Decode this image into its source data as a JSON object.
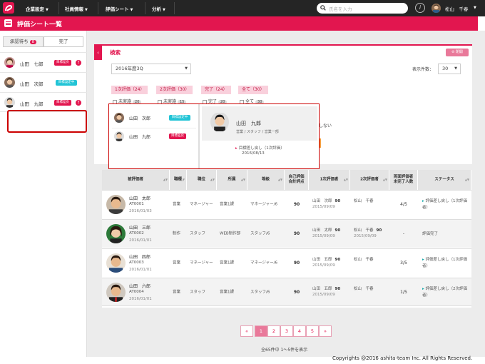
{
  "nav": {
    "items": [
      "企業設定",
      "社員情報",
      "評価シート",
      "分析"
    ],
    "search_placeholder": "氏名を入力",
    "user_name": "松山　千春"
  },
  "page_title": "評価シート一覧",
  "sidebar": {
    "tab_pending": "承認待ち",
    "tab_pending_count": "8",
    "tab_done": "完了",
    "people": [
      {
        "name": "山田　七郎",
        "badge": "目標差戻",
        "badge_color": "#e2164f"
      },
      {
        "name": "山田　次郎",
        "badge": "目標設定中",
        "badge_color": "#22c4d6"
      },
      {
        "name": "山田　九郎",
        "badge": "目標差戻",
        "badge_color": "#e2164f"
      }
    ]
  },
  "search": {
    "title": "検索",
    "close_label": "閉開",
    "period": "2016年度3Q",
    "page_size_label": "表示件数：",
    "page_size": "30",
    "chips": [
      "1次評価（24）",
      "2次評価（30）",
      "完了（24）",
      "全て（30）"
    ],
    "filters": [
      {
        "label": "未実施",
        "count": "20"
      },
      {
        "label": "未実施",
        "count": "15"
      },
      {
        "label": "完了",
        "count": "20"
      },
      {
        "label": "全て",
        "count": "30"
      }
    ],
    "hint": "しない"
  },
  "popup": {
    "list": [
      {
        "name": "山田　次郎",
        "badge": "目標設定中",
        "badge_color": "#22c4d6"
      },
      {
        "name": "山田　九郎",
        "badge": "目標差戻",
        "badge_color": "#e2164f"
      }
    ],
    "card_name": "山田　九郎",
    "card_dept": "営業 / スタッフ / 営業一部",
    "event": "目標差し戻し（1次評価）",
    "event_date": "2016/08/13"
  },
  "table": {
    "headers": [
      "被評価者",
      "職種",
      "職位",
      "所属",
      "等級",
      "自己評価\n合計評点",
      "1次評価者",
      "2次評価者",
      "両面評価者\n未完了人数",
      "ステータス"
    ],
    "rows": [
      {
        "name": "山田　太郎",
        "id": "AT0001",
        "date": "2016/01/03",
        "job": "営業",
        "position": "マネージャー",
        "dept": "営業1課",
        "grade": "マネージャー/6",
        "self_score": "90",
        "ev1_name": "山田　次郎",
        "ev1_score": "90",
        "ev1_date": "2015/09/09",
        "ev2_name": "松山　千春",
        "ev2_score": "",
        "ev2_date": "",
        "remaining": "4/5",
        "status": "評価差し戻し（1次評価者）"
      },
      {
        "name": "山田　三郎",
        "id": "AT0002",
        "date": "2016/01/01",
        "job": "制作",
        "position": "スタッフ",
        "dept": "WEB制作部",
        "grade": "スタッフ/6",
        "self_score": "90",
        "ev1_name": "山田　太郎",
        "ev1_score": "90",
        "ev1_date": "2015/09/09",
        "ev2_name": "松山　千春",
        "ev2_score": "90",
        "ev2_date": "2015/09/09",
        "remaining": "-",
        "status": "評価完了"
      },
      {
        "name": "山田　四郎",
        "id": "AT0003",
        "date": "2016/01/01",
        "job": "営業",
        "position": "マネージャー",
        "dept": "営業1課",
        "grade": "マネージャー/6",
        "self_score": "90",
        "ev1_name": "山田　五郎",
        "ev1_score": "90",
        "ev1_date": "2015/09/09",
        "ev2_name": "松山　千春",
        "ev2_score": "",
        "ev2_date": "",
        "remaining": "3/5",
        "status": "評価差し戻し（1次評価者）"
      },
      {
        "name": "山田　六郎",
        "id": "AT0004",
        "date": "2016/01/01",
        "job": "営業",
        "position": "スタッフ",
        "dept": "営業1課",
        "grade": "スタッフ/6",
        "self_score": "90",
        "ev1_name": "山田　五郎",
        "ev1_score": "90",
        "ev1_date": "2015/09/09",
        "ev2_name": "松山　千春",
        "ev2_score": "",
        "ev2_date": "",
        "remaining": "1/5",
        "status": "評価差し戻し（2次評価者）"
      }
    ]
  },
  "pagination": {
    "pages": [
      "«",
      "1",
      "2",
      "3",
      "4",
      "5",
      "»"
    ],
    "active": "1",
    "total_text": "全65件中 1〜5件を表示"
  },
  "footer": "Copyrights @2016 ashita-team Inc. All Rights Reserved.",
  "colors": {
    "brand": "#e2164f",
    "nav_bg": "#252525",
    "info_badge": "#22c4d6"
  }
}
